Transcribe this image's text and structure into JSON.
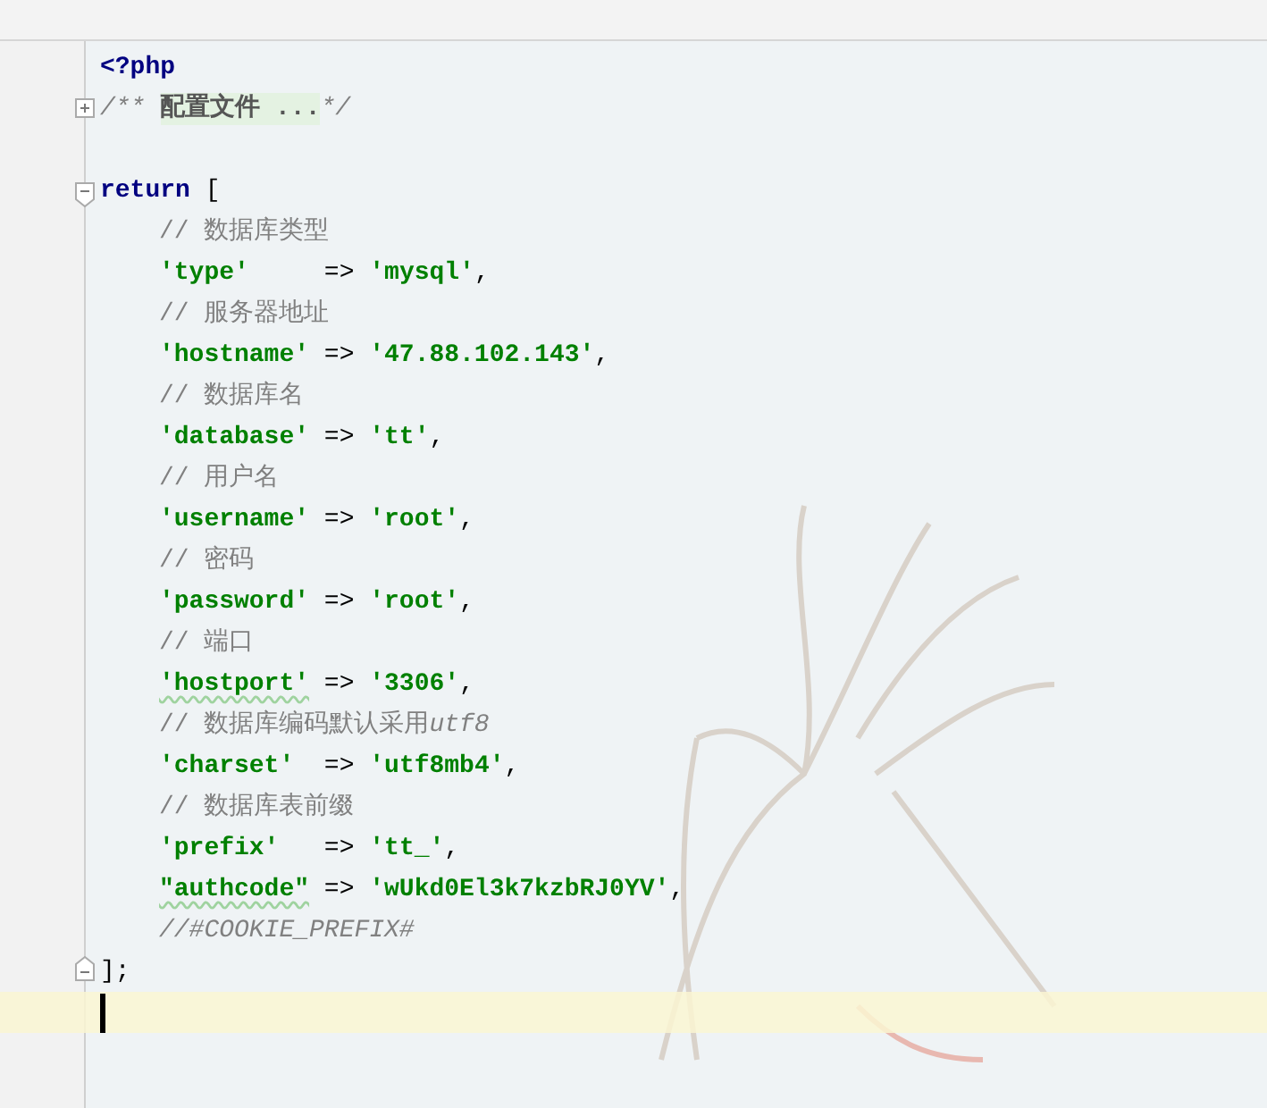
{
  "lines": [
    {
      "indented": false,
      "current": false,
      "tokens": [
        {
          "kind": "keyword",
          "text": "<?php"
        }
      ]
    },
    {
      "fold": {
        "kind": "start",
        "expanded": false
      },
      "indented": false,
      "current": false,
      "tokens": [
        {
          "kind": "doc",
          "text": "/** "
        },
        {
          "kind": "folded",
          "text": "配置文件 ..."
        },
        {
          "kind": "doc",
          "text": "*/"
        }
      ]
    },
    {
      "current": false
    },
    {
      "fold": {
        "kind": "start",
        "expanded": true
      },
      "indented": false,
      "current": false,
      "tokens": [
        {
          "kind": "keyword",
          "text": "return"
        },
        {
          "kind": "plain",
          "text": " ["
        }
      ]
    },
    {
      "indented": true,
      "current": false,
      "tokens": [
        {
          "kind": "comment",
          "text": "// 数据库类型"
        }
      ]
    },
    {
      "indented": true,
      "current": false,
      "tokens": [
        {
          "kind": "string",
          "text": "'type'"
        },
        {
          "kind": "plain",
          "text": "     => "
        },
        {
          "kind": "string",
          "text": "'mysql'"
        },
        {
          "kind": "plain",
          "text": ","
        }
      ]
    },
    {
      "indented": true,
      "current": false,
      "tokens": [
        {
          "kind": "comment",
          "text": "// 服务器地址"
        }
      ]
    },
    {
      "indented": true,
      "current": false,
      "tokens": [
        {
          "kind": "string",
          "text": "'hostname'"
        },
        {
          "kind": "plain",
          "text": " => "
        },
        {
          "kind": "string",
          "text": "'47.88.102.143'"
        },
        {
          "kind": "plain",
          "text": ","
        }
      ]
    },
    {
      "indented": true,
      "current": false,
      "tokens": [
        {
          "kind": "comment",
          "text": "// 数据库名"
        }
      ]
    },
    {
      "indented": true,
      "current": false,
      "tokens": [
        {
          "kind": "string",
          "text": "'database'"
        },
        {
          "kind": "plain",
          "text": " => "
        },
        {
          "kind": "string",
          "text": "'tt'"
        },
        {
          "kind": "plain",
          "text": ","
        }
      ]
    },
    {
      "indented": true,
      "current": false,
      "tokens": [
        {
          "kind": "comment",
          "text": "// 用户名"
        }
      ]
    },
    {
      "indented": true,
      "current": false,
      "tokens": [
        {
          "kind": "string",
          "text": "'username'"
        },
        {
          "kind": "plain",
          "text": " => "
        },
        {
          "kind": "string",
          "text": "'root'"
        },
        {
          "kind": "plain",
          "text": ","
        }
      ]
    },
    {
      "indented": true,
      "current": false,
      "tokens": [
        {
          "kind": "comment",
          "text": "// 密码"
        }
      ]
    },
    {
      "indented": true,
      "current": false,
      "tokens": [
        {
          "kind": "string",
          "text": "'password'"
        },
        {
          "kind": "plain",
          "text": " => "
        },
        {
          "kind": "string",
          "text": "'root'"
        },
        {
          "kind": "plain",
          "text": ","
        }
      ]
    },
    {
      "indented": true,
      "current": false,
      "tokens": [
        {
          "kind": "comment",
          "text": "// 端口"
        }
      ]
    },
    {
      "indented": true,
      "current": false,
      "tokens": [
        {
          "kind": "string",
          "text": "'hostport'",
          "underlined": true
        },
        {
          "kind": "plain",
          "text": " => "
        },
        {
          "kind": "string",
          "text": "'3306'"
        },
        {
          "kind": "plain",
          "text": ","
        }
      ]
    },
    {
      "indented": true,
      "current": false,
      "tokens": [
        {
          "kind": "comment",
          "text": "// 数据库编码默认采用"
        },
        {
          "kind": "doc",
          "text": "utf8"
        }
      ]
    },
    {
      "indented": true,
      "current": false,
      "tokens": [
        {
          "kind": "string",
          "text": "'charset'"
        },
        {
          "kind": "plain",
          "text": "  => "
        },
        {
          "kind": "string",
          "text": "'utf8mb4'"
        },
        {
          "kind": "plain",
          "text": ","
        }
      ]
    },
    {
      "indented": true,
      "current": false,
      "tokens": [
        {
          "kind": "comment",
          "text": "// 数据库表前缀"
        }
      ]
    },
    {
      "indented": true,
      "current": false,
      "tokens": [
        {
          "kind": "string",
          "text": "'prefix'"
        },
        {
          "kind": "plain",
          "text": "   => "
        },
        {
          "kind": "string",
          "text": "'tt_'"
        },
        {
          "kind": "plain",
          "text": ","
        }
      ]
    },
    {
      "indented": true,
      "current": false,
      "tokens": [
        {
          "kind": "string",
          "text": "\"authcode\"",
          "underlined": true
        },
        {
          "kind": "plain",
          "text": " => "
        },
        {
          "kind": "string",
          "text": "'wUkd0El3k7kzbRJ0YV'"
        },
        {
          "kind": "plain",
          "text": ","
        }
      ]
    },
    {
      "indented": true,
      "current": false,
      "tokens": [
        {
          "kind": "doc",
          "text": "//#COOKIE_PREFIX#"
        }
      ]
    },
    {
      "fold": {
        "kind": "end"
      },
      "indented": false,
      "current": false,
      "tokens": [
        {
          "kind": "plain",
          "text": "];"
        }
      ]
    },
    {
      "indented": false,
      "current": true
    }
  ]
}
